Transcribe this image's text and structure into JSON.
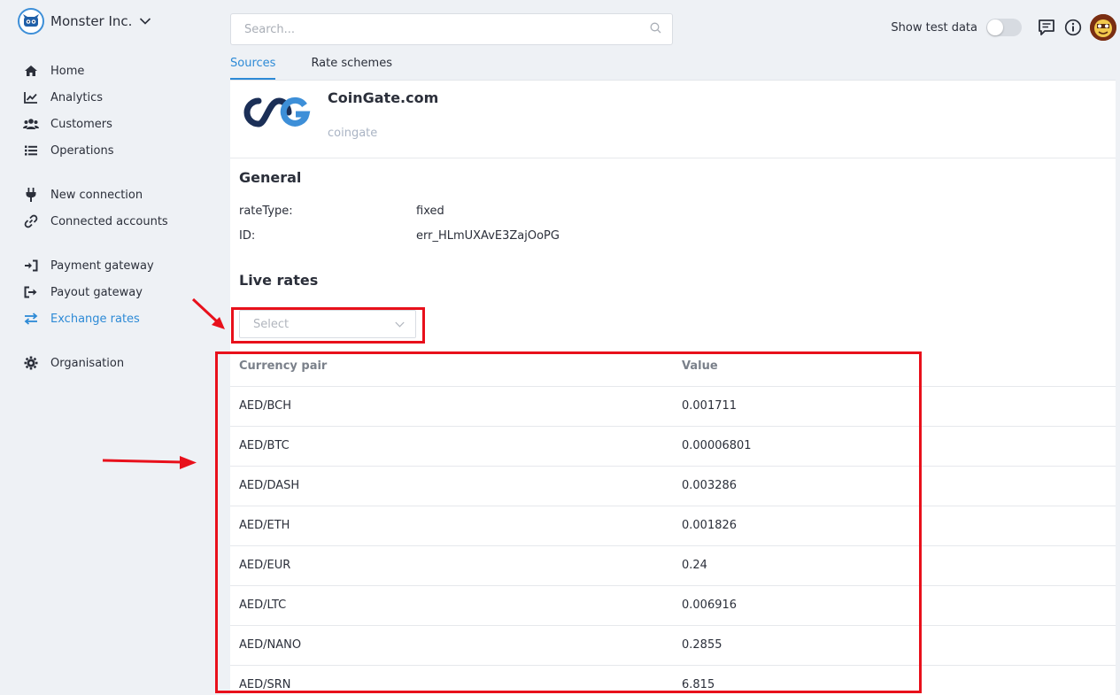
{
  "org": {
    "name": "Monster Inc."
  },
  "nav": {
    "items": [
      {
        "label": "Home",
        "icon": "home-icon"
      },
      {
        "label": "Analytics",
        "icon": "chart-line-icon"
      },
      {
        "label": "Customers",
        "icon": "users-icon"
      },
      {
        "label": "Operations",
        "icon": "list-icon"
      },
      {
        "label": "New connection",
        "icon": "plug-icon"
      },
      {
        "label": "Connected accounts",
        "icon": "link-icon"
      },
      {
        "label": "Payment gateway",
        "icon": "sign-in-icon"
      },
      {
        "label": "Payout gateway",
        "icon": "sign-out-icon"
      },
      {
        "label": "Exchange rates",
        "icon": "exchange-icon",
        "active": true
      },
      {
        "label": "Organisation",
        "icon": "gear-icon"
      }
    ]
  },
  "search": {
    "placeholder": "Search..."
  },
  "topbar": {
    "test_label": "Show test data",
    "test_enabled": false
  },
  "tabs": [
    {
      "label": "Sources",
      "active": true
    },
    {
      "label": "Rate schemes",
      "active": false
    }
  ],
  "source": {
    "name": "CoinGate.com",
    "slug": "coingate"
  },
  "general": {
    "title": "General",
    "rows": [
      {
        "key": "rateType:",
        "value": "fixed"
      },
      {
        "key": "ID:",
        "value": "err_HLmUXAvE3ZajOoPG"
      }
    ]
  },
  "live_rates": {
    "title": "Live rates",
    "select_placeholder": "Select",
    "headers": {
      "pair": "Currency pair",
      "value": "Value"
    },
    "rows": [
      {
        "pair": "AED/BCH",
        "value": "0.001711"
      },
      {
        "pair": "AED/BTC",
        "value": "0.00006801"
      },
      {
        "pair": "AED/DASH",
        "value": "0.003286"
      },
      {
        "pair": "AED/ETH",
        "value": "0.001826"
      },
      {
        "pair": "AED/EUR",
        "value": "0.24"
      },
      {
        "pair": "AED/LTC",
        "value": "0.006916"
      },
      {
        "pair": "AED/NANO",
        "value": "0.2855"
      },
      {
        "pair": "AED/SRN",
        "value": "6.815"
      }
    ]
  },
  "colors": {
    "accent": "#2d8ad6",
    "annotation": "#e8101b",
    "brand_dark": "#1b2f57",
    "brand_light": "#3d8fd8"
  }
}
